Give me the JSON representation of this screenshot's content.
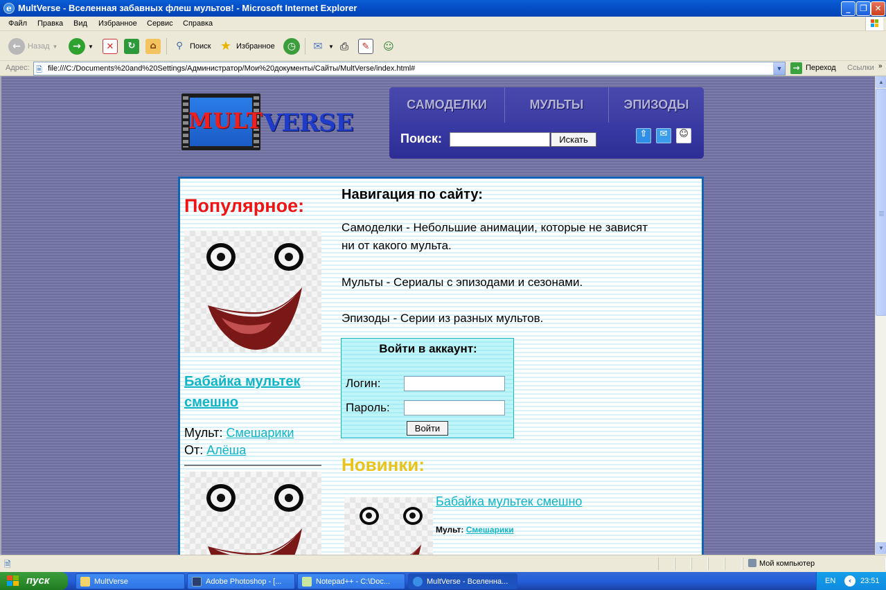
{
  "window": {
    "title": "MultVerse - Вселенная забавных флеш мультов! - Microsoft Internet Explorer",
    "buttons": {
      "minimize": "_",
      "maximize": "❐",
      "close": "✕"
    }
  },
  "menubar": [
    "Файл",
    "Правка",
    "Вид",
    "Избранное",
    "Сервис",
    "Справка"
  ],
  "toolbar": {
    "back": "Назад",
    "search": "Поиск",
    "favorites": "Избранное"
  },
  "addressbar": {
    "label": "Адрес:",
    "url": "file:///C:/Documents%20and%20Settings/Администратор/Мои%20документы/Сайты/MultVerse/index.html#",
    "go": "Переход",
    "links": "Ссылки"
  },
  "site": {
    "logo": {
      "part1": "MULT",
      "part2": "VERSE"
    },
    "nav": [
      "Самоделки",
      "Мульты",
      "Эпизоды"
    ],
    "search": {
      "label": "Поиск:",
      "value": "",
      "button": "Искать"
    },
    "icons": [
      "up-arrow-icon",
      "mail-icon",
      "smiley-icon"
    ],
    "popular": {
      "title": "Популярное:",
      "item": {
        "title": "Бабайка мультек смешно",
        "mult_label": "Мульт:",
        "mult_value": "Смешарики",
        "from_label": "От:",
        "from_value": "Алёша"
      }
    },
    "navigation": {
      "title": "Навигация по сайту:",
      "lines": [
        "Самоделки - Небольшие анимации, которые не зависят",
        "ни от какого мульта.",
        "Мульты - Сериалы с эпизодами и сезонами.",
        "Эпизоды - Серии из разных мультов."
      ]
    },
    "login": {
      "title": "Войти в аккаунт:",
      "login_label": "Логин:",
      "password_label": "Пароль:",
      "login_value": "",
      "password_value": "",
      "button": "Войти"
    },
    "new": {
      "title": "Новинки:",
      "item": {
        "title": "Бабайка мультек смешно",
        "mult_label": "Мульт:",
        "mult_value": "Смешарики"
      }
    }
  },
  "statusbar": {
    "zone": "Мой компьютер"
  },
  "taskbar": {
    "start": "пуск",
    "tasks": [
      "MultVerse",
      "Adobe Photoshop - [...",
      "Notepad++ - C:\\Doc...",
      "MultVerse - Вселенна..."
    ],
    "lang": "EN",
    "clock": "23:51"
  },
  "colors": {
    "title_red": "#f01313",
    "link_cyan": "#0fb4c6",
    "new_yellow": "#e9c31a",
    "nav_bg": "#3b3ba6",
    "page_bg": "#7a7aa8"
  }
}
